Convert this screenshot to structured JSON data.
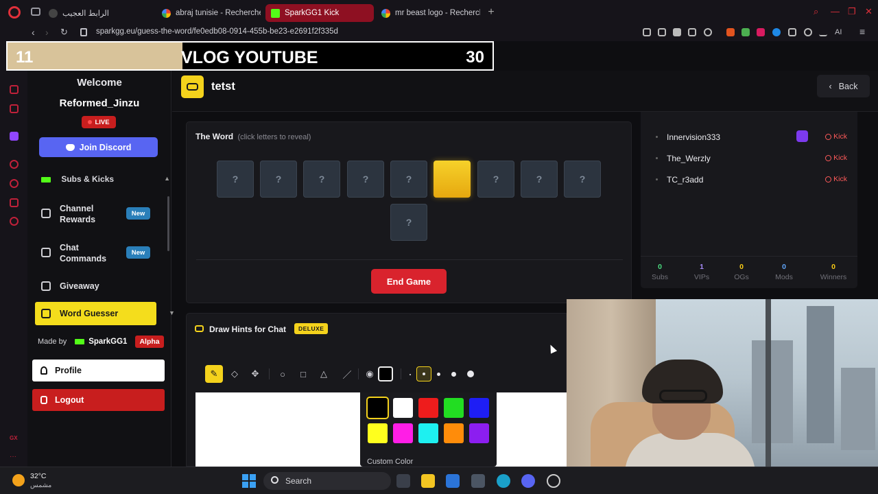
{
  "browser": {
    "tabs": [
      {
        "title": "الرابط العجيب",
        "active": false
      },
      {
        "title": "abraj tunisie - Recherche",
        "active": false
      },
      {
        "title": "SparkGG1 Kick",
        "active": true
      },
      {
        "title": "mr beast logo - Recherche",
        "active": false
      }
    ],
    "url": "sparkgg.eu/guess-the-word/fe0edb08-0914-455b-be23-e2691f2f335d",
    "ai_label": "AI"
  },
  "overlay": {
    "left_number": "11",
    "title": "VLOG YOUTUBE",
    "right_number": "30",
    "progress": 0.36
  },
  "sidebar": {
    "welcome": "Welcome",
    "username": "Reformed_Jinzu",
    "live_label": "LIVE",
    "discord_label": "Join Discord",
    "section_label": "Subs & Kicks",
    "items": [
      {
        "label": "Channel Rewards",
        "badge": "New",
        "icon": "gift-icon"
      },
      {
        "label": "Chat Commands",
        "badge": "New",
        "icon": "command-icon"
      },
      {
        "label": "Giveaway",
        "badge": "",
        "icon": "giveaway-icon"
      },
      {
        "label": "Word Guesser",
        "badge": "",
        "icon": "gamepad-icon",
        "active": true
      }
    ],
    "made_by_label": "Made by",
    "brand": "SparkGG1",
    "alpha": "Alpha",
    "profile_label": "Profile",
    "logout_label": "Logout"
  },
  "header": {
    "title": "tetst",
    "back_label": "Back"
  },
  "word_panel": {
    "title": "The Word",
    "hint": "(click letters to reveal)",
    "letters": [
      "?",
      "?",
      "?",
      "?",
      "?",
      "",
      "?",
      "?",
      "?",
      "?"
    ],
    "revealed_index": 5,
    "end_game_label": "End Game"
  },
  "users": {
    "list": [
      {
        "name": "Innervision333",
        "kick_label": "Kick",
        "vip": true
      },
      {
        "name": "The_Werzly",
        "kick_label": "Kick",
        "vip": false
      },
      {
        "name": "TC_r3add",
        "kick_label": "Kick",
        "vip": false
      }
    ],
    "stats": [
      {
        "value": "0",
        "label": "Subs",
        "color": "#4ade80"
      },
      {
        "value": "1",
        "label": "VIPs",
        "color": "#a78bfa"
      },
      {
        "value": "0",
        "label": "OGs",
        "color": "#facc15"
      },
      {
        "value": "0",
        "label": "Mods",
        "color": "#60a5fa"
      },
      {
        "value": "0",
        "label": "Winners",
        "color": "#facc15"
      }
    ]
  },
  "draw_panel": {
    "title": "Draw Hints for Chat",
    "badge": "DELUXE",
    "palette": [
      "#000000",
      "#ffffff",
      "#ee1c1c",
      "#22dd22",
      "#1e1ef5",
      "#ffff1e",
      "#ff1ee6",
      "#1ef0f0",
      "#ff8c0a",
      "#8c1ef0"
    ],
    "custom_color_label": "Custom Color"
  },
  "taskbar": {
    "temperature": "32°C",
    "condition": "مشمس",
    "search_label": "Search"
  }
}
